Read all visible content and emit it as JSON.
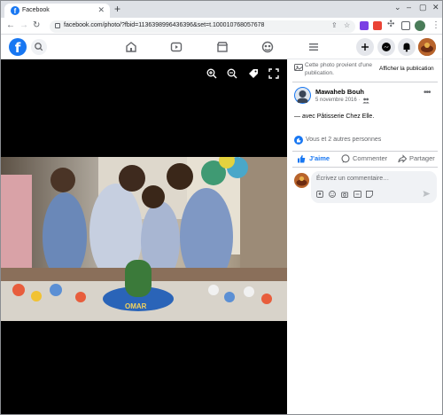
{
  "browser": {
    "tab_title": "Facebook",
    "tab_favicon": "f",
    "url": "facebook.com/photo/?fbid=1136398996436396&set=t.100010768057678"
  },
  "fb": {
    "logo": "f"
  },
  "notice": {
    "text_line1": "Cette photo provient d'une",
    "text_line2": "publication.",
    "action": "Afficher la publication"
  },
  "post": {
    "author": "Mawaheb Bouh",
    "date": "5 novembre 2016 ·",
    "caption_prefix": "— avec",
    "caption_tag": "Pâtisserie Chez Elle",
    "caption_suffix": ".",
    "reactions": "Vous et 2 autres personnes"
  },
  "actions": {
    "like": "J'aime",
    "comment": "Commenter",
    "share": "Partager"
  },
  "comment_box": {
    "placeholder": "Écrivez un commentaire…"
  },
  "photo": {
    "cake_text": "OMAR"
  },
  "colors": {
    "facebook_blue": "#1877f2",
    "viewer_bg": "#000000",
    "like_blue": "#1877f2"
  }
}
